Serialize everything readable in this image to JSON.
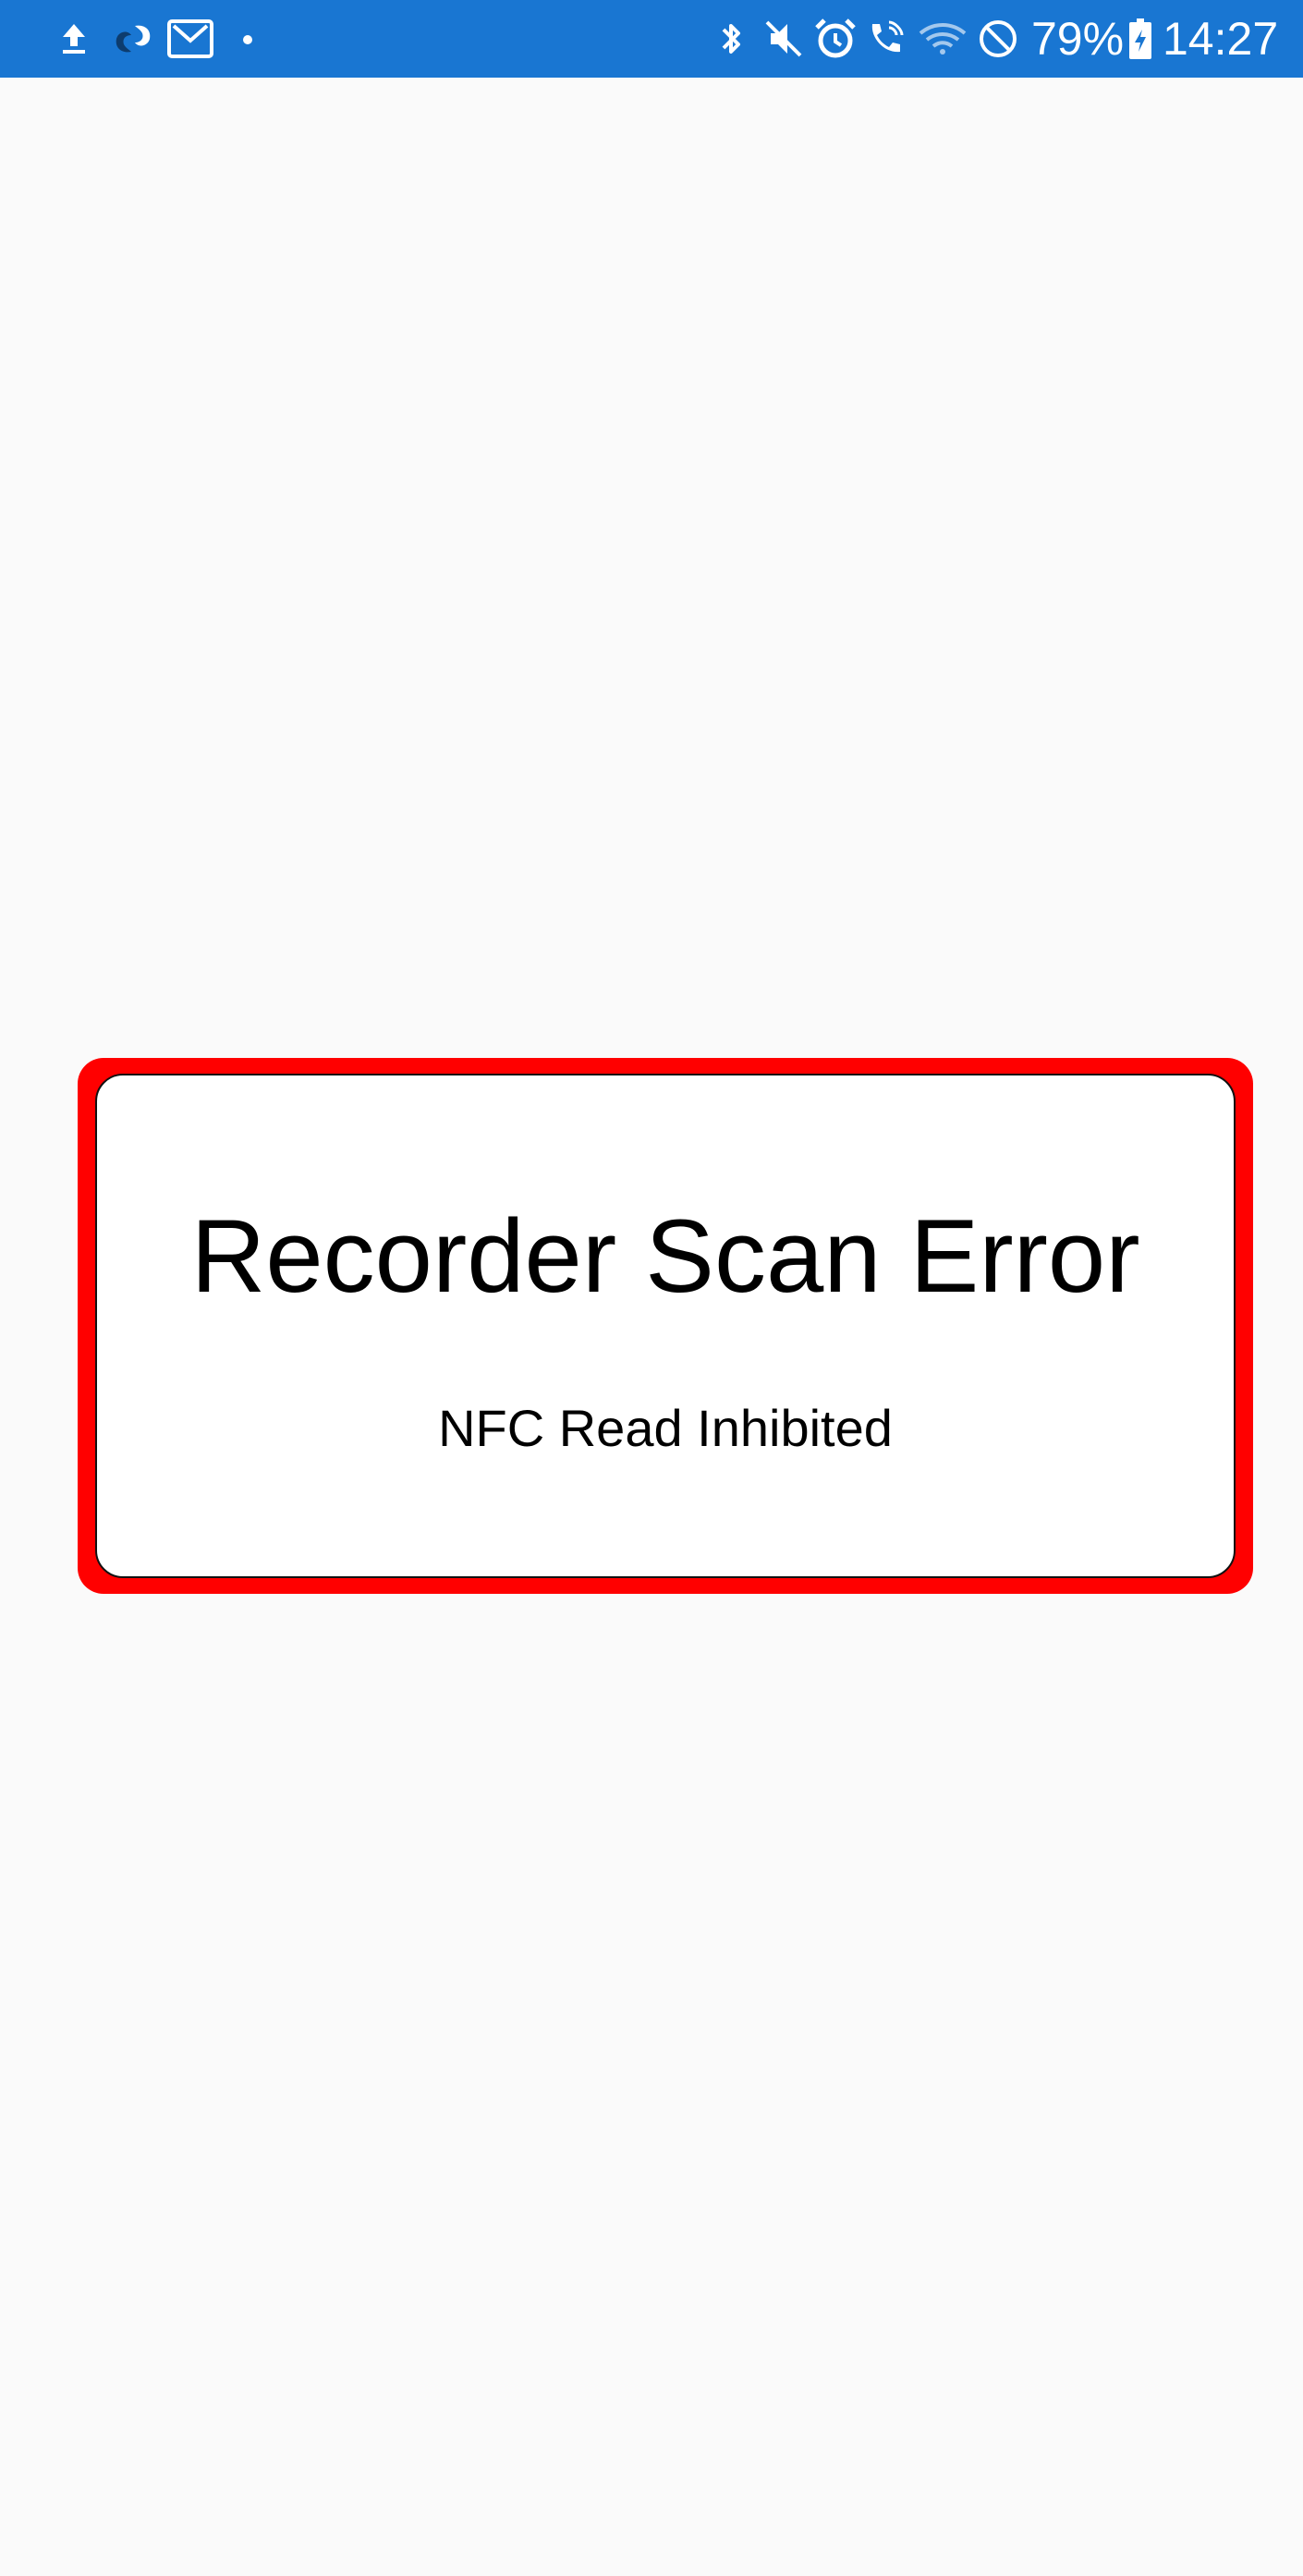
{
  "status_bar": {
    "background_color": "#1976d2",
    "left_icons": [
      "upload-icon",
      "sync-app-icon",
      "gmail-icon",
      "more-notifications-dot-icon"
    ],
    "right_icons": [
      "bluetooth-icon",
      "mute-icon",
      "alarm-icon",
      "wifi-calling-icon",
      "wifi-icon",
      "do-not-disturb-icon",
      "battery-charging-icon"
    ],
    "battery_percent": "79%",
    "time": "14:27"
  },
  "dialog": {
    "border_color": "#ff0000",
    "title": "Recorder Scan Error",
    "message": "NFC Read Inhibited"
  }
}
